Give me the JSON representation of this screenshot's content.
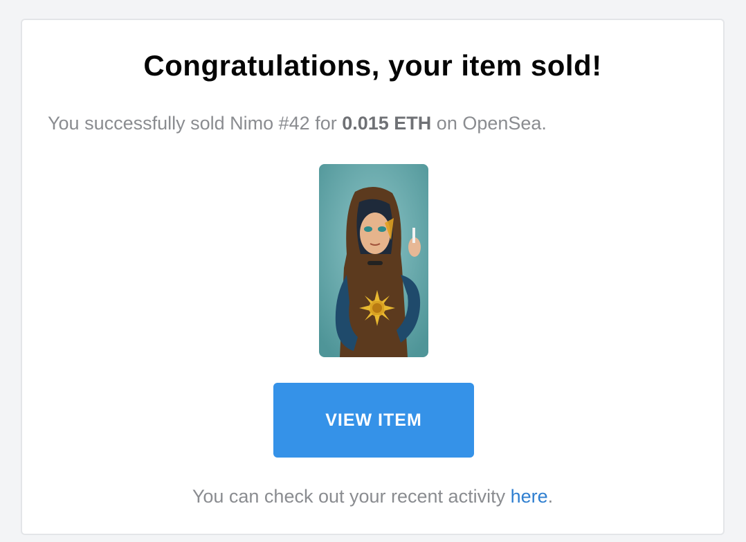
{
  "title": "Congratulations, your item sold!",
  "message": {
    "prefix": "You successfully sold Nimo #42 for ",
    "price": "0.015 ETH",
    "suffix": " on OpenSea."
  },
  "button": {
    "label": "VIEW ITEM"
  },
  "footer": {
    "prefix": "You can check out your recent activity ",
    "link": "here",
    "suffix": "."
  },
  "colors": {
    "button": "#3592e8",
    "link": "#2f7fd0",
    "text_muted": "#8a8c90",
    "card_border": "#e3e5e8"
  }
}
